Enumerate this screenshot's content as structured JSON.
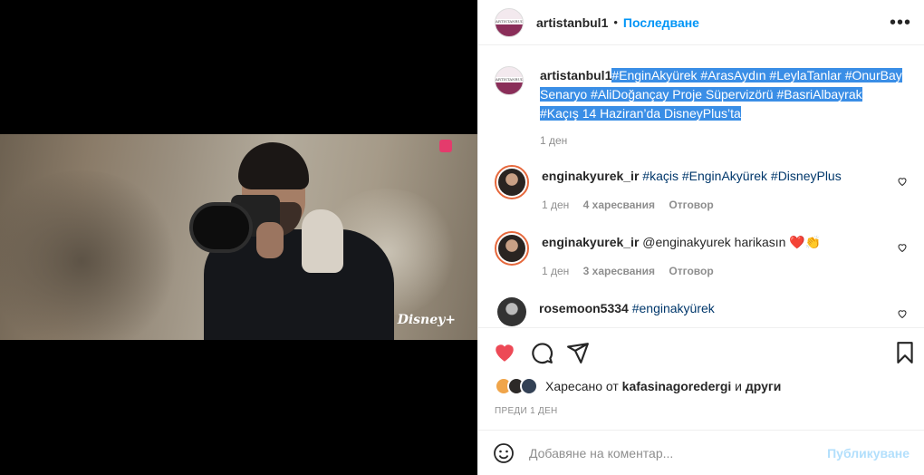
{
  "post": {
    "username": "artistanbul1",
    "avatar_text": "ARTISTANBUL",
    "follow_label": "Последване",
    "more_label": "•••",
    "caption_user": "artistanbul1",
    "caption_text": "#EnginAkyürek #ArasAydın #LeylaTanlar #OnurBay Senaryo #AliDoğançay Proje Süpervizörü #BasriAlbayrak #Kaçış 14 Haziran’da DisneyPlus’ta",
    "caption_time": "1 ден",
    "video_badge": "Disney+"
  },
  "comments": [
    {
      "user": "enginakyurek_ir",
      "text": "#kaçis #EnginAkyürek #DisneyPlus",
      "time": "1 ден",
      "likes": "4 харесвания",
      "reply": "Отговор"
    },
    {
      "user": "enginakyurek_ir",
      "text": "@enginakyurek harikasın ❤️👏",
      "time": "1 ден",
      "likes": "3 харесвания",
      "reply": "Отговор"
    },
    {
      "user": "rosemoon5334",
      "text": "#enginakyürek"
    }
  ],
  "actions": {
    "liked": true,
    "like_color": "#ed4956"
  },
  "likes": {
    "prefix": "Харесано от",
    "user": "kafasinagoredergi",
    "conj": "и",
    "others": "други",
    "ago": "ПРЕДИ 1 ДЕН"
  },
  "add_comment": {
    "placeholder": "Добавяне на коментар...",
    "publish_label": "Публикуване"
  },
  "colors": {
    "link": "#0095f6",
    "hashtag": "#00376b",
    "muted": "#8e8e8e",
    "selection": "#3a8ee6"
  }
}
